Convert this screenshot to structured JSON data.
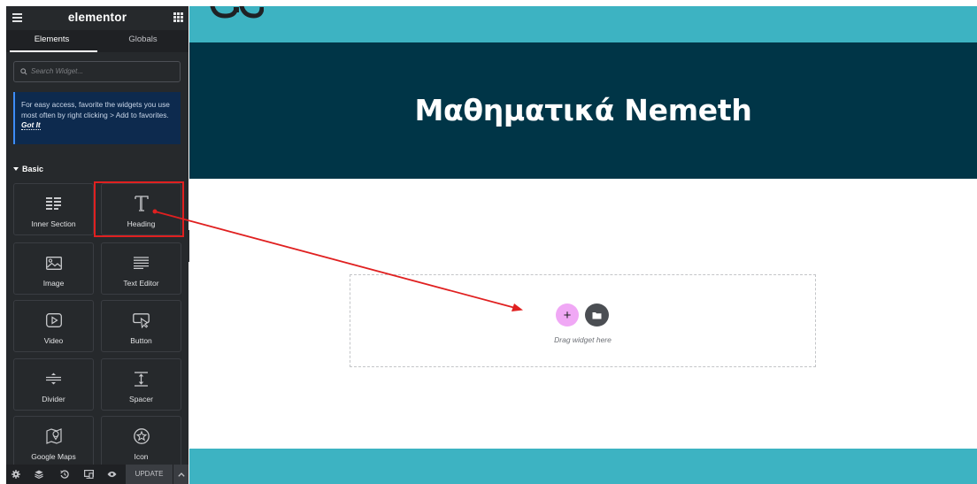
{
  "panel": {
    "brand": "elementor",
    "tabs": [
      {
        "label": "Elements",
        "active": true
      },
      {
        "label": "Globals",
        "active": false
      }
    ],
    "search": {
      "placeholder": "Search Widget..."
    },
    "notice": {
      "text": "For easy access, favorite the widgets you use most often by right clicking > Add to favorites.",
      "link": "Got It"
    },
    "category": "Basic",
    "widgets": [
      {
        "label": "Inner Section",
        "icon": "inner-section-icon"
      },
      {
        "label": "Heading",
        "icon": "heading-icon"
      },
      {
        "label": "Image",
        "icon": "image-icon"
      },
      {
        "label": "Text Editor",
        "icon": "text-editor-icon"
      },
      {
        "label": "Video",
        "icon": "video-icon"
      },
      {
        "label": "Button",
        "icon": "button-icon"
      },
      {
        "label": "Divider",
        "icon": "divider-icon"
      },
      {
        "label": "Spacer",
        "icon": "spacer-icon"
      },
      {
        "label": "Google Maps",
        "icon": "google-maps-icon"
      },
      {
        "label": "Icon",
        "icon": "star-icon"
      }
    ],
    "footer": {
      "icons": [
        "settings-icon",
        "navigator-icon",
        "history-icon",
        "responsive-icon",
        "preview-icon"
      ],
      "update_label": "UPDATE"
    }
  },
  "canvas": {
    "hero_title": "Μαθηματικά Nemeth",
    "dropzone_text": "Drag widget here"
  },
  "colors": {
    "panel_bg": "#26292c",
    "teal_strip": "#3db3c2",
    "hero_bg": "#003547",
    "add_button": "#f0a8f5",
    "annotation_red": "#e02020"
  }
}
